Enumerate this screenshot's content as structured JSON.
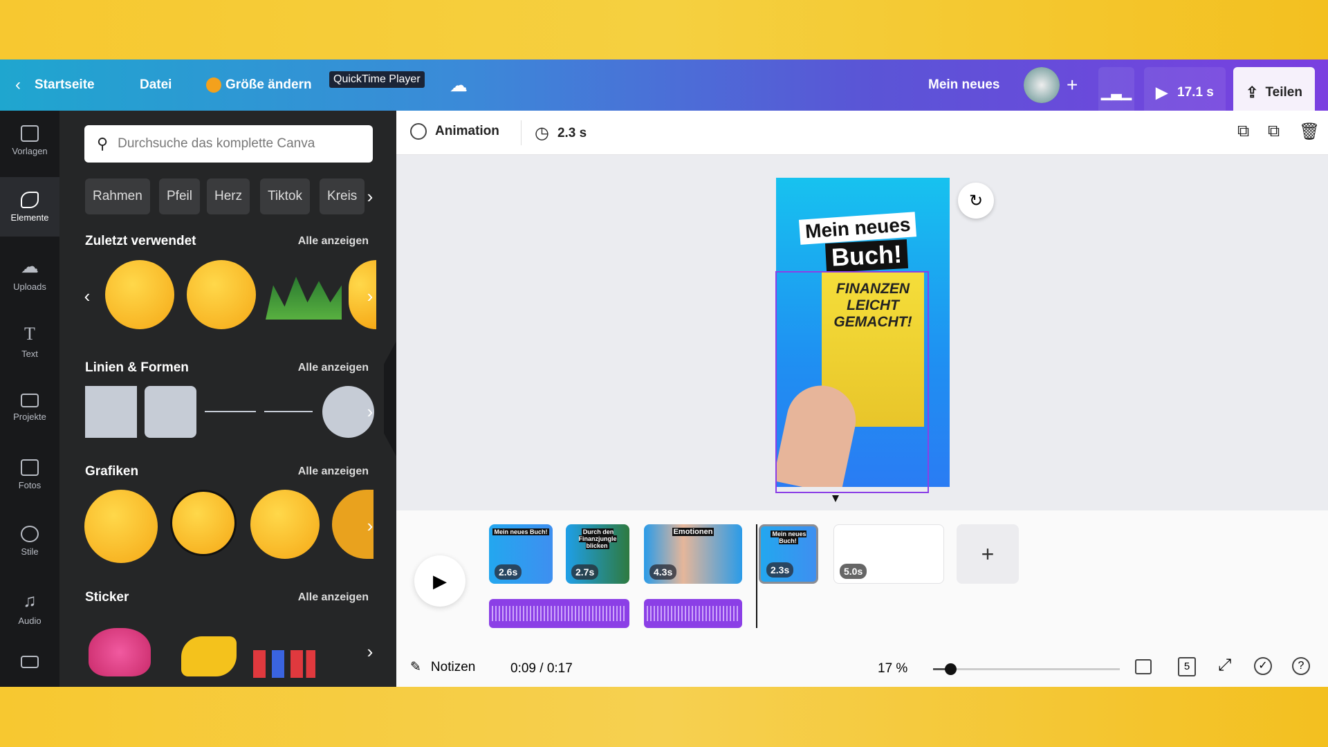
{
  "header": {
    "back_label": "Startseite",
    "file_label": "Datei",
    "resize_label": "Größe ändern",
    "tooltip": "QuickTime Player",
    "project_title": "Mein neues",
    "play_duration": "17.1 s",
    "share_label": "Teilen"
  },
  "sidebar": {
    "items": [
      {
        "label": "Vorlagen"
      },
      {
        "label": "Elemente"
      },
      {
        "label": "Uploads"
      },
      {
        "label": "Text"
      },
      {
        "label": "Projekte"
      },
      {
        "label": "Fotos"
      },
      {
        "label": "Stile"
      },
      {
        "label": "Audio"
      }
    ],
    "active": "Elemente"
  },
  "panel": {
    "search_placeholder": "Durchsuche das komplette Canva",
    "chips": [
      "Rahmen",
      "Pfeil",
      "Herz",
      "Tiktok",
      "Kreis"
    ],
    "sections": [
      {
        "title": "Zuletzt verwendet",
        "see_all": "Alle anzeigen"
      },
      {
        "title": "Linien & Formen",
        "see_all": "Alle anzeigen"
      },
      {
        "title": "Grafiken",
        "see_all": "Alle anzeigen"
      },
      {
        "title": "Sticker",
        "see_all": "Alle anzeigen"
      }
    ]
  },
  "toolbar": {
    "animation_label": "Animation",
    "duration": "2.3 s"
  },
  "design": {
    "title_line1": "Mein neues",
    "title_line2": "Buch!",
    "book_title": "FINANZEN LEICHT GEMACHT!"
  },
  "timeline": {
    "clips": [
      {
        "duration": "2.6s",
        "caption": "Mein neues Buch!"
      },
      {
        "duration": "2.7s",
        "caption": "Durch den Finanzjungle blicken"
      },
      {
        "duration": "4.3s",
        "caption": "Emotionen"
      },
      {
        "duration": "2.3s",
        "caption": "Mein neues Buch!",
        "selected": true
      },
      {
        "duration": "5.0s",
        "caption": ""
      }
    ]
  },
  "footer": {
    "notes_label": "Notizen",
    "time": "0:09 / 0:17",
    "zoom": "17 %",
    "zoom_level_percent": 17,
    "page_count": "5"
  },
  "colors": {
    "accent": "#8b3fe6",
    "header_start": "#1fa6cf",
    "header_end": "#7a3fe0"
  }
}
